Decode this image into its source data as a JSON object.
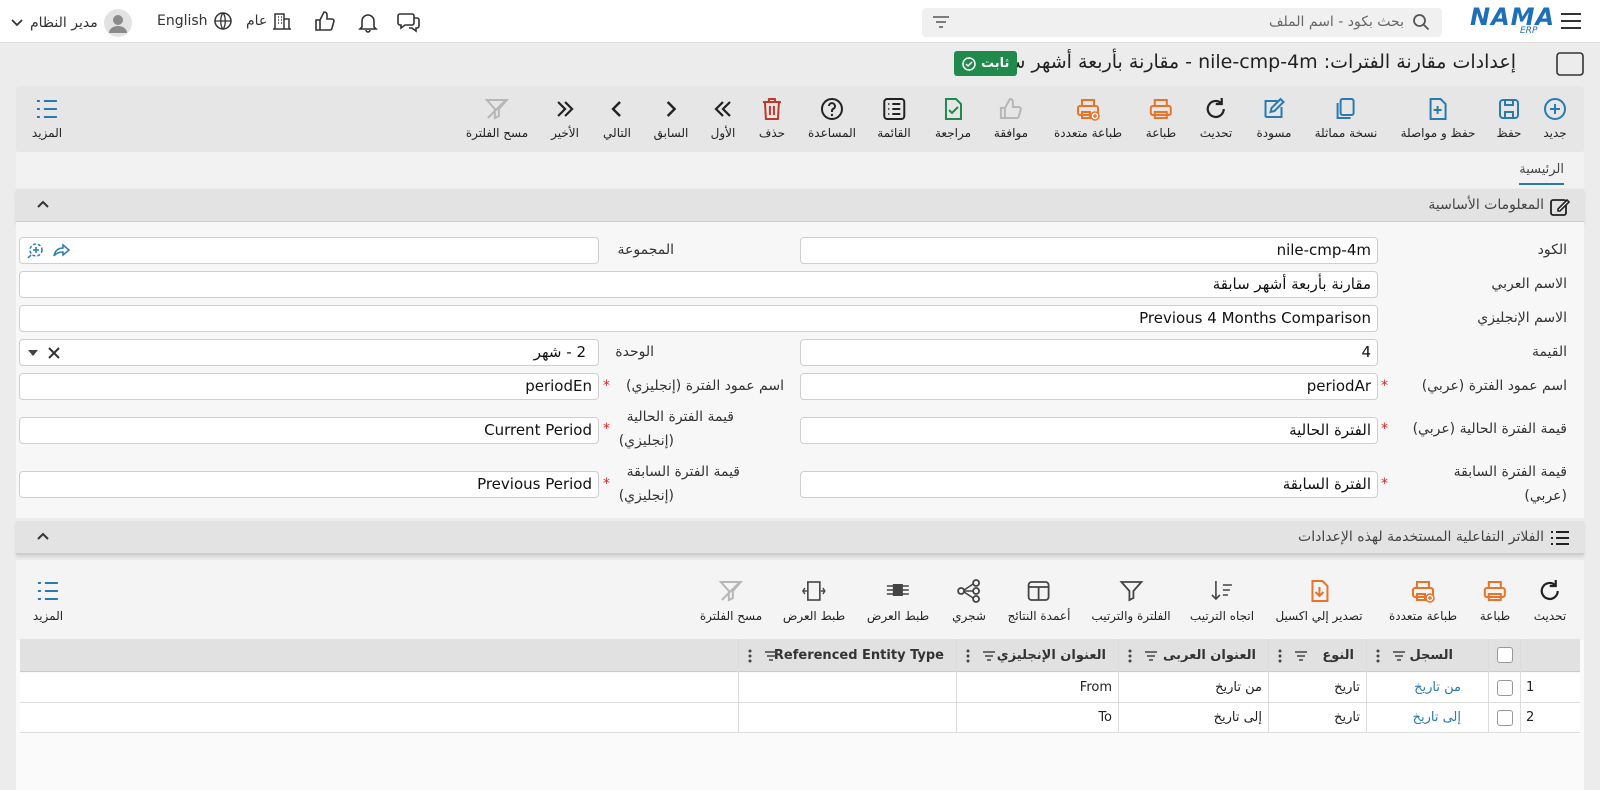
{
  "brand": {
    "name": "NAMA",
    "sub": "ERP",
    "color": "#1d6fb8"
  },
  "topbar": {
    "search_placeholder": "بحث بكود - اسم الملف",
    "user_label": "مدير النظام",
    "language_label": "English",
    "branch_label": "عام"
  },
  "page": {
    "title": "إعدادات مقارنة الفترات: nile-cmp-4m - مقارنة بأربعة أشهر سابقة",
    "status_badge": "ثابت"
  },
  "toolbar": {
    "buttons": [
      {
        "label": "جديد",
        "icon": "plus-circle-icon"
      },
      {
        "label": "حفظ",
        "icon": "save-icon"
      },
      {
        "label": "حفظ و مواصلة",
        "icon": "save-continue-icon"
      },
      {
        "label": "نسخة مماثلة",
        "icon": "duplicate-icon"
      },
      {
        "label": "مسودة",
        "icon": "draft-icon"
      },
      {
        "label": "تحديث",
        "icon": "refresh-icon"
      },
      {
        "label": "طباعة",
        "icon": "print-icon"
      },
      {
        "label": "طباعة متعددة",
        "icon": "multi-print-icon"
      },
      {
        "label": "موافقة",
        "icon": "thumbs-up-icon"
      },
      {
        "label": "مراجعة",
        "icon": "review-icon"
      },
      {
        "label": "القائمة",
        "icon": "list-icon"
      },
      {
        "label": "المساعدة",
        "icon": "help-icon"
      },
      {
        "label": "حذف",
        "icon": "trash-icon"
      },
      {
        "label": "الأول",
        "icon": "first-icon"
      },
      {
        "label": "السابق",
        "icon": "previous-icon"
      },
      {
        "label": "التالي",
        "icon": "next-icon"
      },
      {
        "label": "الأخير",
        "icon": "last-icon"
      },
      {
        "label": "مسح الفلترة",
        "icon": "clear-filter-icon"
      }
    ],
    "more_label": "المزيد"
  },
  "tabs": {
    "main": "الرئيسية"
  },
  "basic_info": {
    "title": "المعلومات الأساسية",
    "fields": {
      "code": {
        "label": "الكود",
        "value": "nile-cmp-4m"
      },
      "group": {
        "label": "المجموعة",
        "value": ""
      },
      "arabic_name": {
        "label": "الاسم العربي",
        "value": "مقارنة بأربعة أشهر سابقة"
      },
      "english_name": {
        "label": "الاسم الإنجليزي",
        "value": "Previous 4 Months Comparison"
      },
      "value": {
        "label": "القيمة",
        "value": "4"
      },
      "unit": {
        "label": "الوحدة",
        "value": "2 - شهر"
      },
      "period_col_ar": {
        "label": "اسم عمود الفترة (عربي)",
        "value": "periodAr"
      },
      "period_col_en": {
        "label": "اسم عمود الفترة (إنجليزي)",
        "value": "periodEn"
      },
      "current_ar": {
        "label": "قيمة الفترة الحالية (عربي)",
        "value": "الفترة الحالية"
      },
      "current_en": {
        "label1": "قيمة الفترة الحالية",
        "label2": "(إنجليزي)",
        "value": "Current Period"
      },
      "previous_ar": {
        "label1": "قيمة الفترة السابقة",
        "label2": "(عربي)",
        "value": "الفترة السابقة"
      },
      "previous_en": {
        "label1": "قيمة الفترة السابقة",
        "label2": "(إنجليزي)",
        "value": "Previous Period"
      }
    }
  },
  "filters_section": {
    "title": "الفلاتر التفاعلية المستخدمة لهذه الإعدادات",
    "toolbar": [
      {
        "label": "تحديث",
        "icon": "refresh-icon"
      },
      {
        "label": "طباعة",
        "icon": "print-icon"
      },
      {
        "label": "طباعة متعددة",
        "icon": "multi-print-icon"
      },
      {
        "label": "تصدير إلي اكسيل",
        "icon": "excel-export-icon"
      },
      {
        "label": "اتجاه الترتيب",
        "icon": "sort-direction-icon"
      },
      {
        "label": "الفلترة والترتيب",
        "icon": "filter-icon"
      },
      {
        "label": "أعمدة النتائج",
        "icon": "columns-icon"
      },
      {
        "label": "شجري",
        "icon": "tree-icon"
      },
      {
        "label": "طبط العرض",
        "icon": "fit-width-icon"
      },
      {
        "label": "طبط العرض",
        "icon": "autosize-icon"
      },
      {
        "label": "مسح الفلترة",
        "icon": "clear-filter-icon"
      }
    ],
    "more_label": "المزيد",
    "columns": [
      "السجل",
      "النوع",
      "العنوان العربى",
      "العنوان الإنجليزي",
      "Referenced Entity Type"
    ],
    "rows": [
      {
        "num": "1",
        "record": "من تاريخ",
        "type": "تاريخ",
        "title_ar": "من تاريخ",
        "title_en": "From",
        "ref": ""
      },
      {
        "num": "2",
        "record": "إلى تاريخ",
        "type": "تاريخ",
        "title_ar": "إلى تاريخ",
        "title_en": "To",
        "ref": ""
      }
    ]
  },
  "colors": {
    "accent": "#2a7ab0",
    "danger": "#c0392b",
    "print": "#e8742a",
    "success": "#1f8a4c"
  }
}
